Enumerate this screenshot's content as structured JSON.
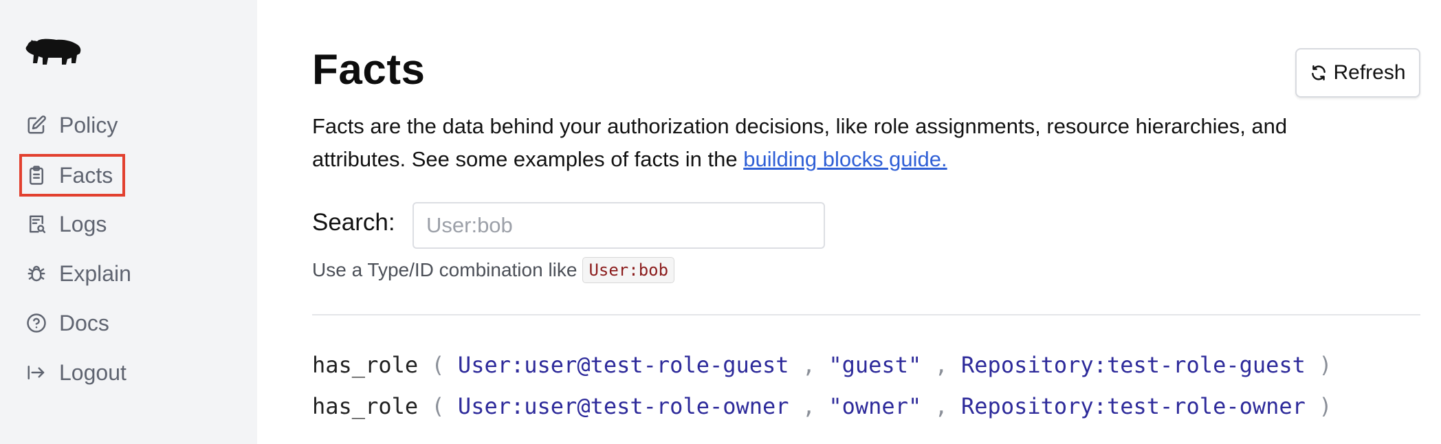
{
  "sidebar": {
    "logo": "bear-logo",
    "items": [
      {
        "label": "Policy",
        "icon": "edit-icon"
      },
      {
        "label": "Facts",
        "icon": "clipboard-icon"
      },
      {
        "label": "Logs",
        "icon": "search-document-icon"
      },
      {
        "label": "Explain",
        "icon": "bug-icon"
      },
      {
        "label": "Docs",
        "icon": "help-circle-icon"
      },
      {
        "label": "Logout",
        "icon": "logout-icon"
      }
    ],
    "highlight_color": "#e2402f"
  },
  "main": {
    "title": "Facts",
    "refresh_label": "Refresh",
    "description_text": "Facts are the data behind your authorization decisions, like role assignments, resource hierarchies, and attributes. See some examples of facts in the ",
    "description_link": "building blocks guide.",
    "search_label": "Search:",
    "search_placeholder": "User:bob",
    "search_value": "",
    "hint_text": "Use a Type/ID combination like",
    "hint_code": "User:bob",
    "link_color": "#2f5fd6"
  },
  "facts": [
    {
      "predicate": "has_role",
      "args": [
        "User:user@test-role-guest",
        "\"guest\"",
        "Repository:test-role-guest"
      ]
    },
    {
      "predicate": "has_role",
      "args": [
        "User:user@test-role-owner",
        "\"owner\"",
        "Repository:test-role-owner"
      ]
    }
  ]
}
